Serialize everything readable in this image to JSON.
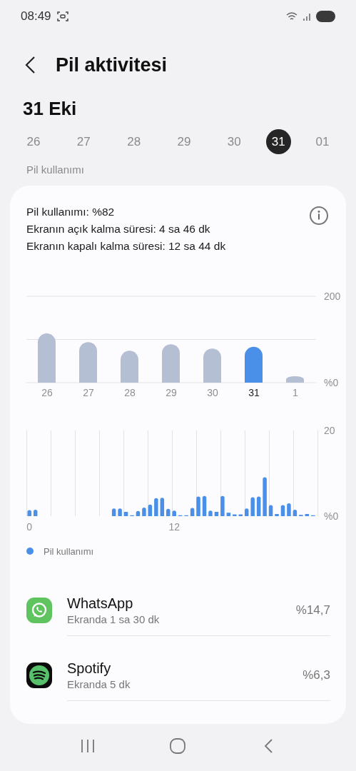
{
  "status_bar": {
    "time": "08:49"
  },
  "header": {
    "title": "Pil aktivitesi"
  },
  "date_heading": "31 Eki",
  "days": [
    {
      "label": "26",
      "selected": false
    },
    {
      "label": "27",
      "selected": false
    },
    {
      "label": "28",
      "selected": false
    },
    {
      "label": "29",
      "selected": false
    },
    {
      "label": "30",
      "selected": false
    },
    {
      "label": "31",
      "selected": true
    },
    {
      "label": "01",
      "selected": false
    }
  ],
  "section_label": "Pil kullanımı",
  "summary": {
    "lines": [
      "Pil kullanımı: %82",
      "Ekranın açık kalma süresi: 4 sa 46 dk",
      "Ekranın kapalı kalma süresi: 12 sa 44 dk"
    ]
  },
  "daily_chart": {
    "chart_data": {
      "type": "bar",
      "stacked": true,
      "categories": [
        "26",
        "27",
        "28",
        "29",
        "30",
        "31",
        "1"
      ],
      "series": [
        {
          "color": "#b4bfd3",
          "values": [
            114,
            94,
            74,
            89,
            79,
            null,
            15
          ]
        },
        {
          "color": "#4a8fe8",
          "values": [
            null,
            null,
            null,
            null,
            null,
            83,
            null
          ]
        }
      ],
      "ylim": [
        0,
        200
      ],
      "yticks": [
        {
          "value": 0,
          "label": "%0"
        },
        {
          "value": 100,
          "label": null
        },
        {
          "value": 200,
          "label": "200"
        }
      ]
    }
  },
  "hourly_chart": {
    "chart_data": {
      "type": "bar",
      "categories": [
        "0",
        null,
        null,
        null,
        null,
        null,
        null,
        null,
        null,
        null,
        null,
        null,
        null,
        null,
        null,
        null,
        null,
        null,
        null,
        null,
        null,
        null,
        null,
        null,
        "12",
        null,
        null,
        null,
        null,
        null,
        null,
        null,
        null,
        null,
        null,
        null,
        null,
        null,
        null,
        null,
        null,
        null,
        null,
        null,
        null,
        null,
        null,
        null
      ],
      "series": [
        {
          "name": "Pil kullanımı",
          "color": "#4a8fe8",
          "values": [
            1.4,
            1.5,
            null,
            null,
            null,
            null,
            null,
            null,
            null,
            null,
            null,
            null,
            null,
            null,
            1.8,
            1.8,
            1.0,
            0.2,
            1.2,
            2.0,
            2.7,
            4.2,
            4.3,
            1.7,
            1.3,
            0.2,
            0.2,
            1.9,
            4.6,
            4.7,
            1.3,
            1.0,
            4.7,
            0.8,
            0.4,
            0.4,
            1.8,
            4.4,
            4.6,
            9.1,
            2.6,
            0.5,
            2.6,
            3.0,
            1.5,
            0.3,
            0.5,
            0.2
          ]
        }
      ],
      "ylim": [
        0,
        20
      ],
      "yticks": [
        {
          "value": 0,
          "label": "%0"
        },
        {
          "value": 20,
          "label": "20"
        }
      ]
    }
  },
  "apps": [
    {
      "kind": "whatsapp",
      "name": "WhatsApp",
      "screen_time": "Ekranda 1 sa 30 dk",
      "usage": "%14,7"
    },
    {
      "kind": "spotify",
      "name": "Spotify",
      "screen_time": "Ekranda 5 dk",
      "usage": "%6,3"
    }
  ]
}
